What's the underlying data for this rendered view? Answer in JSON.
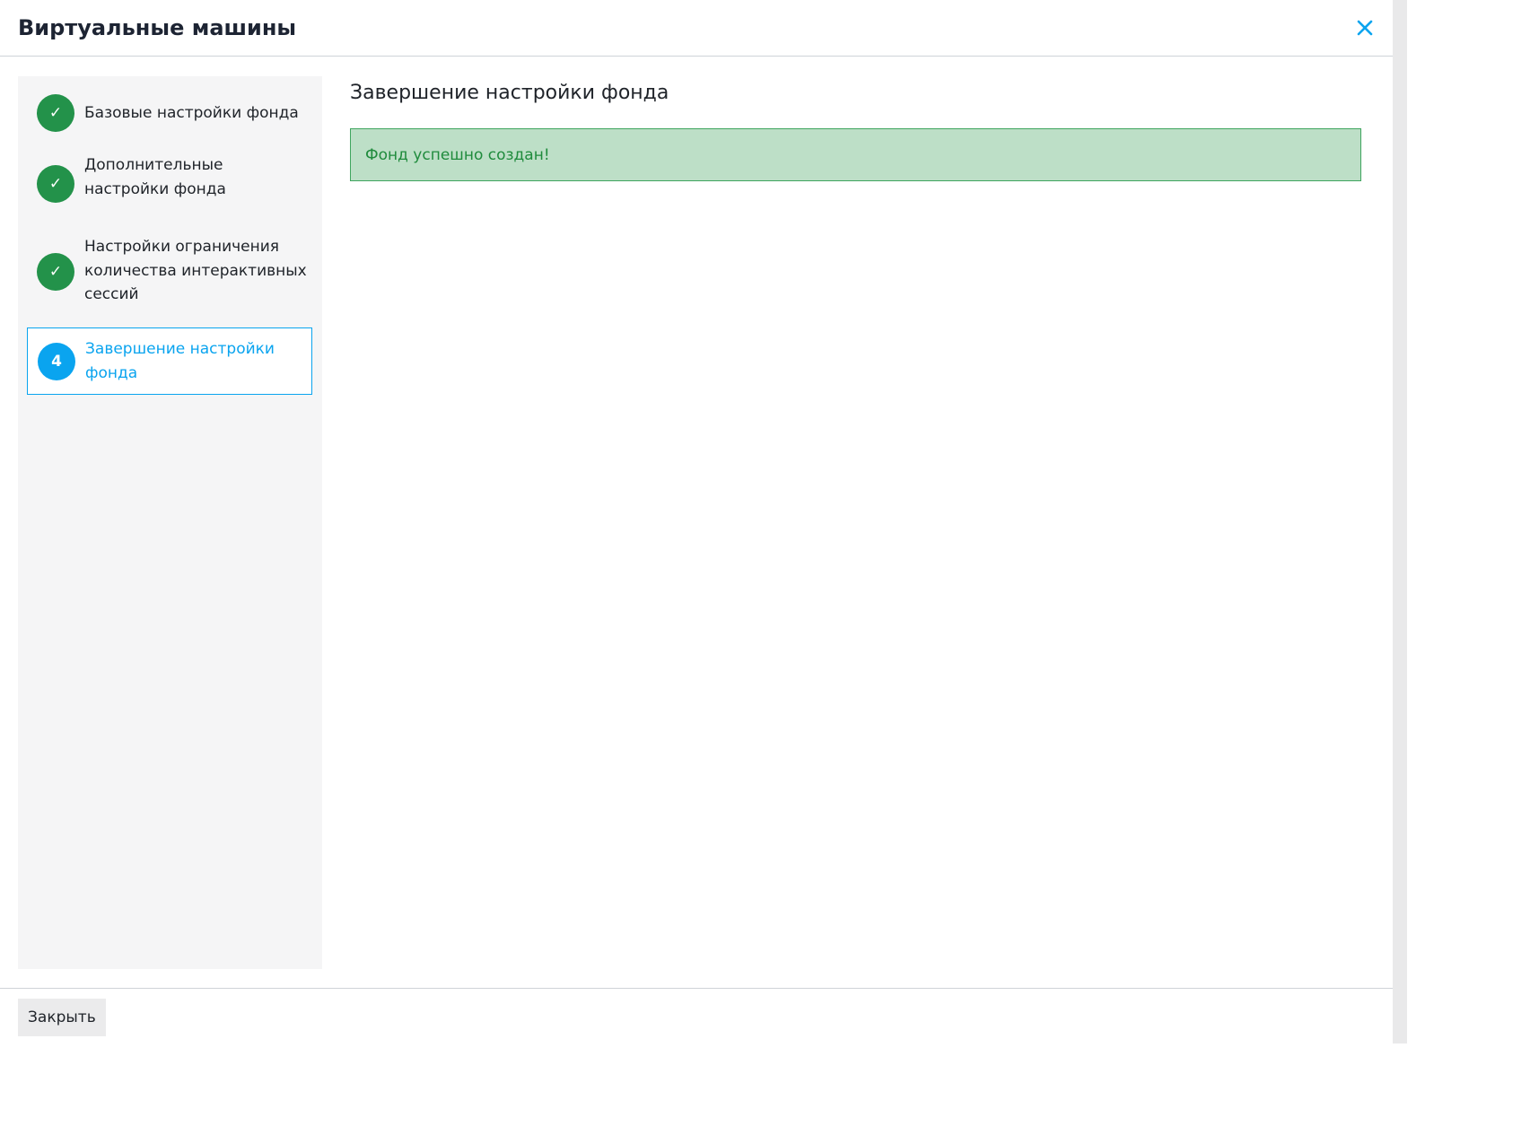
{
  "dialog": {
    "title": "Виртуальные машины",
    "close_icon": "close-icon"
  },
  "steps": [
    {
      "marker": "✓",
      "label": "Базовые настройки фонда",
      "state": "done"
    },
    {
      "marker": "✓",
      "label": "Дополнительные настройки фонда",
      "state": "done"
    },
    {
      "marker": "✓",
      "label": "Настройки ограничения количества интерактивных сессий",
      "state": "done"
    },
    {
      "marker": "4",
      "label": "Завершение настройки фонда",
      "state": "active"
    }
  ],
  "main": {
    "title": "Завершение настройки фонда",
    "alert_text": "Фонд успешно создан!"
  },
  "footer": {
    "close_label": "Закрыть"
  },
  "colors": {
    "accent": "#0aa4ef",
    "success": "#23924a",
    "alert_bg": "#bddfc7"
  }
}
